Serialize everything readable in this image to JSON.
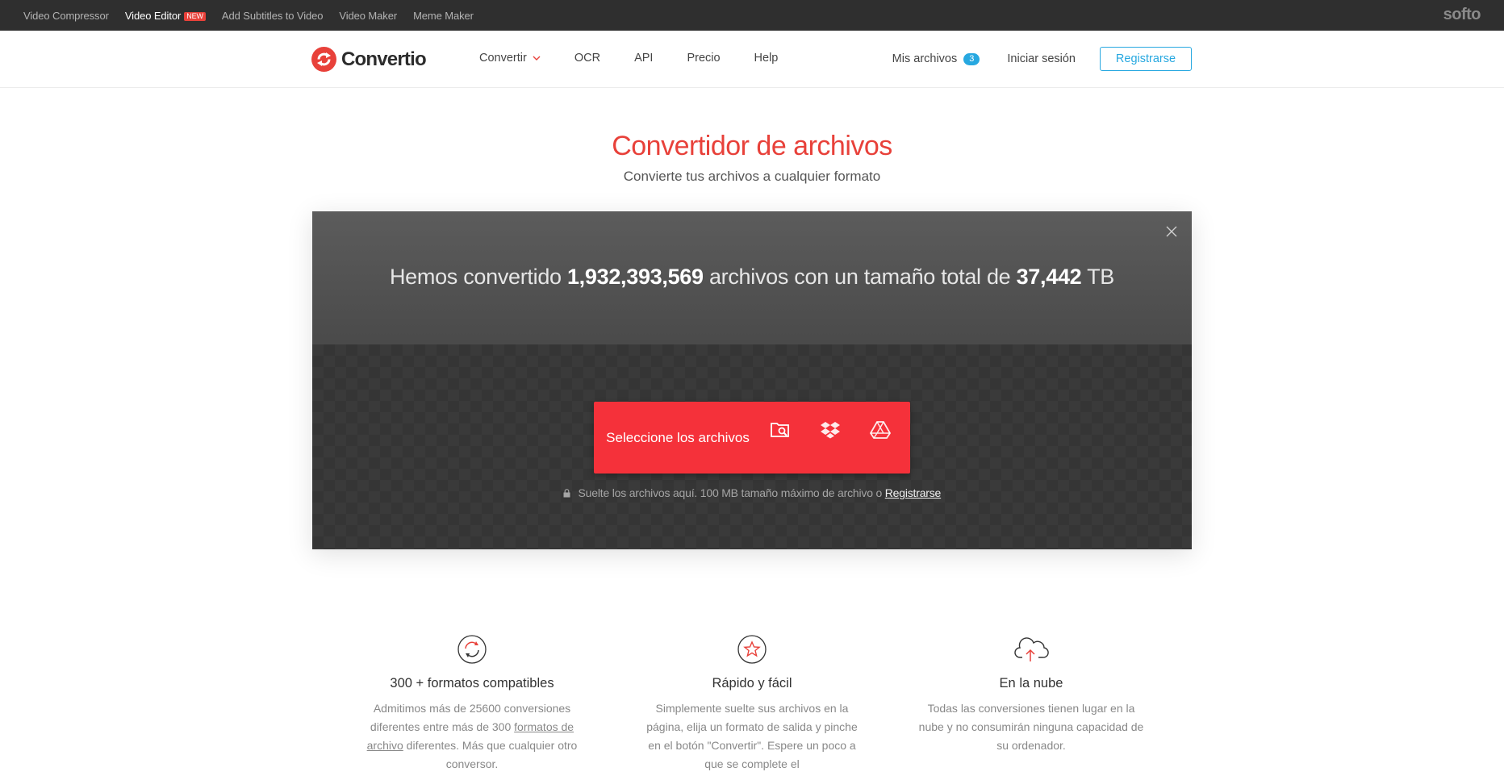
{
  "topbar": {
    "links": [
      {
        "label": "Video Compressor"
      },
      {
        "label": "Video Editor",
        "badge": "NEW"
      },
      {
        "label": "Add Subtitles to Video"
      },
      {
        "label": "Video Maker"
      },
      {
        "label": "Meme Maker"
      }
    ],
    "brand": "softo"
  },
  "header": {
    "logo_text": "Convertio",
    "nav": [
      {
        "label": "Convertir",
        "has_dropdown": true
      },
      {
        "label": "OCR"
      },
      {
        "label": "API"
      },
      {
        "label": "Precio"
      },
      {
        "label": "Help"
      }
    ],
    "my_files_label": "Mis archivos",
    "my_files_count": "3",
    "login_label": "Iniciar sesión",
    "register_label": "Registrarse"
  },
  "hero": {
    "title": "Convertidor de archivos",
    "subtitle": "Convierte tus archivos a cualquier formato"
  },
  "converter": {
    "stats_prefix": "Hemos convertido",
    "files_count": "1,932,393,569",
    "stats_middle": "archivos con un tamaño total de",
    "total_size": "37,442",
    "size_unit": "TB",
    "select_label": "Seleccione los archivos",
    "drop_hint": "Suelte los archivos aquí. 100 MB tamaño máximo de archivo o",
    "drop_hint_link": "Registrarse"
  },
  "features": [
    {
      "icon": "refresh-icon",
      "title": "300 + formatos compatibles",
      "text_before": "Admitimos más de 25600 conversiones diferentes entre más de 300",
      "link": "formatos de archivo",
      "text_after": "diferentes. Más que cualquier otro conversor."
    },
    {
      "icon": "star-icon",
      "title": "Rápido y fácil",
      "text": "Simplemente suelte sus archivos en la página, elija un formato de salida y pinche en el botón \"Convertir\". Espere un poco a que se complete el"
    },
    {
      "icon": "cloud-upload-icon",
      "title": "En la nube",
      "text": "Todas las conversiones tienen lugar en la nube y no consumirán ninguna capacidad de su ordenador."
    }
  ],
  "colors": {
    "brand_red": "#e8413a",
    "button_red": "#f5313a",
    "accent_blue": "#27a8e0",
    "topbar_bg": "#2f2f2f"
  }
}
